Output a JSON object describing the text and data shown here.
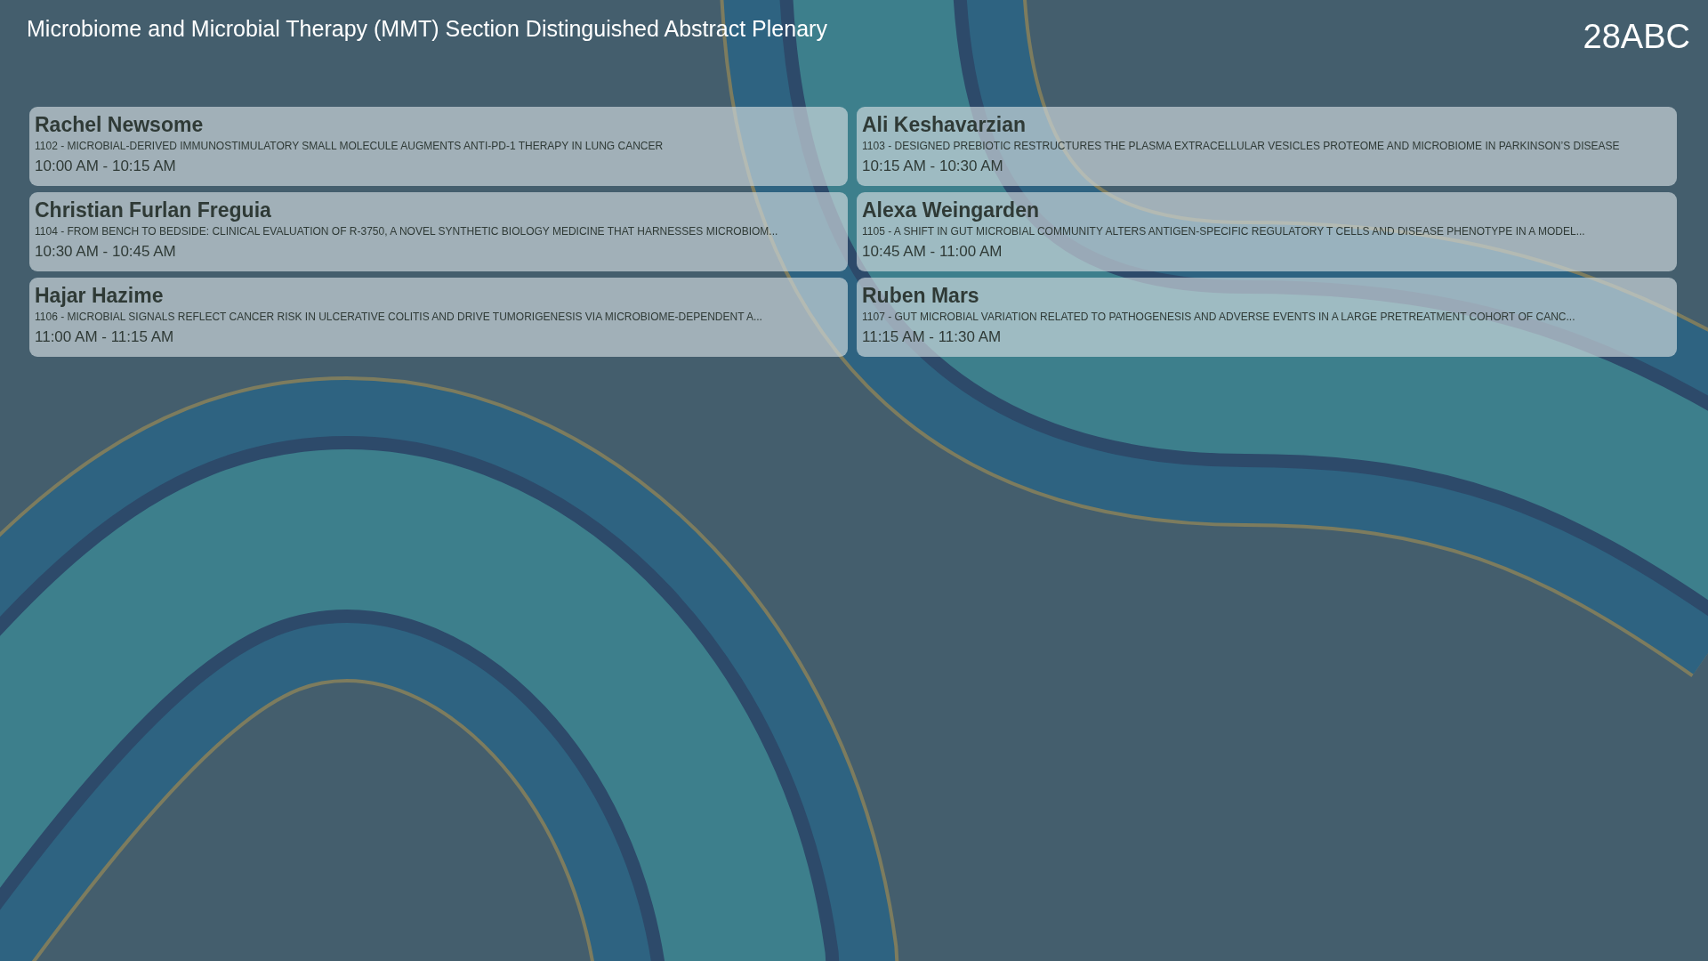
{
  "header": {
    "title": "Microbiome and Microbial Therapy (MMT) Section Distinguished Abstract Plenary",
    "room": "28ABC"
  },
  "sessions": [
    {
      "speaker": "Rachel Newsome",
      "abstract": "1102 - MICROBIAL-DERIVED IMMUNOSTIMULATORY SMALL MOLECULE AUGMENTS ANTI-PD-1 THERAPY IN LUNG CANCER",
      "time": "10:00 AM - 10:15 AM"
    },
    {
      "speaker": "Ali Keshavarzian",
      "abstract": "1103 - DESIGNED PREBIOTIC RESTRUCTURES THE PLASMA EXTRACELLULAR VESICLES PROTEOME AND MICROBIOME IN PARKINSON’S DISEASE",
      "time": "10:15 AM - 10:30 AM"
    },
    {
      "speaker": "Christian Furlan Freguia",
      "abstract": "1104 - FROM BENCH TO BEDSIDE: CLINICAL EVALUATION OF R-3750, A NOVEL SYNTHETIC BIOLOGY MEDICINE THAT HARNESSES MICROBIOM...",
      "time": "10:30 AM - 10:45 AM"
    },
    {
      "speaker": "Alexa Weingarden",
      "abstract": "1105 - A SHIFT IN GUT MICROBIAL COMMUNITY ALTERS ANTIGEN-SPECIFIC REGULATORY T CELLS AND DISEASE PHENOTYPE IN A MODEL...",
      "time": "10:45 AM - 11:00 AM"
    },
    {
      "speaker": "Hajar Hazime",
      "abstract": "1106 - MICROBIAL SIGNALS REFLECT CANCER RISK IN ULCERATIVE COLITIS AND DRIVE TUMORIGENESIS VIA MICROBIOME-DEPENDENT A...",
      "time": "11:00 AM - 11:15 AM"
    },
    {
      "speaker": "Ruben Mars",
      "abstract": "1107 - GUT MICROBIAL VARIATION RELATED TO PATHOGENESIS AND ADVERSE EVENTS IN A LARGE PRETREATMENT COHORT OF CANC...",
      "time": "11:15 AM - 11:30 AM"
    }
  ]
}
